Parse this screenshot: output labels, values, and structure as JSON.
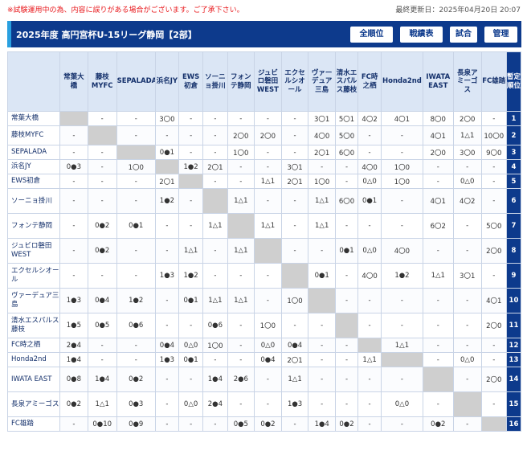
{
  "notice": "※試験運用中の為、内容に誤りがある場合がございます。ご了承下さい。",
  "updated": "最終更新日：2025年04月20日 20:07",
  "title": "2025年度 高円宮杯U-15リーグ静岡【2部】",
  "buttons": [
    "全順位",
    "戦績表",
    "試合",
    "管理"
  ],
  "colors": {
    "header_bg": "#0d3a8c",
    "accent": "#29a0e0",
    "notice": "#e8171b",
    "self_cell": "#cfcfcf"
  },
  "rank_header": "暫定順位",
  "teams": [
    {
      "col": "常葉大橋",
      "row": "常葉大橋",
      "rank": "1"
    },
    {
      "col": "藤枝MYFC",
      "row": "藤枝MYFC",
      "rank": "2"
    },
    {
      "col": "SEPALADA",
      "row": "SEPALADA",
      "rank": "3"
    },
    {
      "col": "浜名JY",
      "row": "浜名JY",
      "rank": "4"
    },
    {
      "col": "EWS初倉",
      "row": "EWS初倉",
      "rank": "5"
    },
    {
      "col": "ソーニョ掛川",
      "row": "ソーニョ掛川",
      "rank": "6"
    },
    {
      "col": "フォンテ静岡",
      "row": "フォンテ静岡",
      "rank": "7"
    },
    {
      "col": "ジュビロ磐田WEST",
      "row": "ジュビロ磐田WEST",
      "rank": "8"
    },
    {
      "col": "エクセルシオール",
      "row": "エクセルシオール",
      "rank": "9"
    },
    {
      "col": "ヴァーデュア三島",
      "row": "ヴァーデュア三島",
      "rank": "10"
    },
    {
      "col": "清水エスパルス藤枝",
      "row": "清水エスパルス藤枝",
      "rank": "11"
    },
    {
      "col": "FC時之栖",
      "row": "FC時之栖",
      "rank": "12"
    },
    {
      "col": "Honda2nd",
      "row": "Honda2nd",
      "rank": "13"
    },
    {
      "col": "IWATA EAST",
      "row": "IWATA EAST",
      "rank": "14"
    },
    {
      "col": "長泉アミーゴス",
      "row": "長泉アミーゴス",
      "rank": "15"
    },
    {
      "col": "FC雄踏",
      "row": "FC雄踏",
      "rank": "16"
    }
  ],
  "results": [
    [
      "",
      "-",
      "-",
      "3〇0",
      "-",
      "-",
      "-",
      "-",
      "-",
      "3〇1",
      "5〇1",
      "4〇2",
      "4〇1",
      "8〇0",
      "2〇0",
      "-"
    ],
    [
      "-",
      "",
      "-",
      "-",
      "-",
      "-",
      "2〇0",
      "2〇0",
      "-",
      "4〇0",
      "5〇0",
      "-",
      "-",
      "4〇1",
      "1△1",
      "10〇0"
    ],
    [
      "-",
      "-",
      "",
      "0●1",
      "-",
      "-",
      "1〇0",
      "-",
      "-",
      "2〇1",
      "6〇0",
      "-",
      "-",
      "2〇0",
      "3〇0",
      "9〇0"
    ],
    [
      "0●3",
      "-",
      "1〇0",
      "",
      "1●2",
      "2〇1",
      "-",
      "-",
      "3〇1",
      "-",
      "-",
      "4〇0",
      "1〇0",
      "-",
      "-",
      "-"
    ],
    [
      "-",
      "-",
      "-",
      "2〇1",
      "",
      "-",
      "-",
      "1△1",
      "2〇1",
      "1〇0",
      "-",
      "0△0",
      "1〇0",
      "-",
      "0△0",
      "-"
    ],
    [
      "-",
      "-",
      "-",
      "1●2",
      "-",
      "",
      "1△1",
      "-",
      "-",
      "1△1",
      "6〇0",
      "0●1",
      "-",
      "4〇1",
      "4〇2",
      "-"
    ],
    [
      "-",
      "0●2",
      "0●1",
      "-",
      "-",
      "1△1",
      "",
      "1△1",
      "-",
      "1△1",
      "-",
      "-",
      "-",
      "6〇2",
      "-",
      "5〇0"
    ],
    [
      "-",
      "0●2",
      "-",
      "-",
      "1△1",
      "-",
      "1△1",
      "",
      "-",
      "-",
      "0●1",
      "0△0",
      "4〇0",
      "-",
      "-",
      "2〇0"
    ],
    [
      "-",
      "-",
      "-",
      "1●3",
      "1●2",
      "-",
      "-",
      "-",
      "",
      "0●1",
      "-",
      "4〇0",
      "1●2",
      "1△1",
      "3〇1",
      "-"
    ],
    [
      "1●3",
      "0●4",
      "1●2",
      "-",
      "0●1",
      "1△1",
      "1△1",
      "-",
      "1〇0",
      "",
      "-",
      "-",
      "-",
      "-",
      "-",
      "4〇1"
    ],
    [
      "1●5",
      "0●5",
      "0●6",
      "-",
      "-",
      "0●6",
      "-",
      "1〇0",
      "-",
      "-",
      "",
      "-",
      "-",
      "-",
      "-",
      "2〇0"
    ],
    [
      "2●4",
      "-",
      "-",
      "0●4",
      "0△0",
      "1〇0",
      "-",
      "0△0",
      "0●4",
      "-",
      "-",
      "",
      "1△1",
      "-",
      "-",
      "-"
    ],
    [
      "1●4",
      "-",
      "-",
      "1●3",
      "0●1",
      "-",
      "-",
      "0●4",
      "2〇1",
      "-",
      "-",
      "1△1",
      "",
      "-",
      "0△0",
      "-"
    ],
    [
      "0●8",
      "1●4",
      "0●2",
      "-",
      "-",
      "1●4",
      "2●6",
      "-",
      "1△1",
      "-",
      "-",
      "-",
      "-",
      "",
      "-",
      "2〇0"
    ],
    [
      "0●2",
      "1△1",
      "0●3",
      "-",
      "0△0",
      "2●4",
      "-",
      "-",
      "1●3",
      "-",
      "-",
      "-",
      "0△0",
      "-",
      "",
      "-"
    ],
    [
      "-",
      "0●10",
      "0●9",
      "-",
      "-",
      "-",
      "0●5",
      "0●2",
      "-",
      "1●4",
      "0●2",
      "-",
      "-",
      "0●2",
      "-",
      ""
    ]
  ]
}
